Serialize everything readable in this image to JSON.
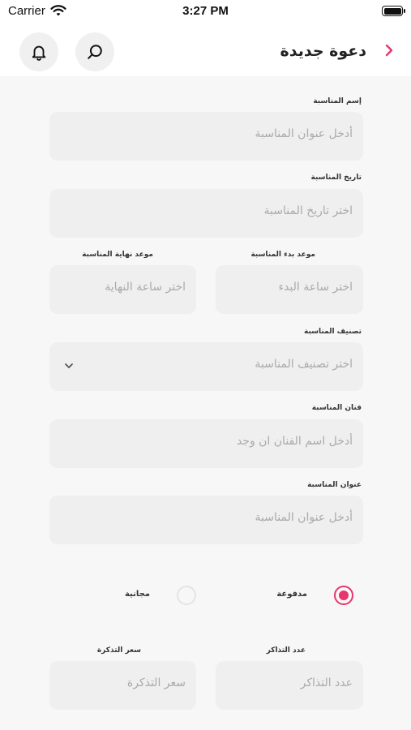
{
  "status_bar": {
    "carrier": "Carrier",
    "time": "3:27 PM"
  },
  "header": {
    "title": "دعوة جديدة"
  },
  "form": {
    "event_name": {
      "label": "إسم المناسبة",
      "placeholder": "أدخل عنوان المناسبة"
    },
    "event_date": {
      "label": "تاريخ المناسبة",
      "placeholder": "اختر تاريخ المناسبة"
    },
    "start_time": {
      "label": "موعد بدء المناسبة",
      "placeholder": "اختر ساعة البدء"
    },
    "end_time": {
      "label": "موعد نهاية المناسبة",
      "placeholder": "اختر ساعة النهاية"
    },
    "category": {
      "label": "تصنيف المناسبة",
      "placeholder": "اختر تصنيف المناسبة"
    },
    "artist": {
      "label": "فنان المناسبة",
      "placeholder": "أدخل اسم الفنان ان وجد"
    },
    "address": {
      "label": "عنوان المناسبة",
      "placeholder": "أدخل عنوان المناسبة"
    },
    "payment": {
      "paid_label": "مدفوعة",
      "free_label": "مجانية",
      "selected": "paid"
    },
    "ticket_count": {
      "label": "عدد التذاكر",
      "placeholder": "عدد التذاكر"
    },
    "ticket_price": {
      "label": "سعر التذكرة",
      "placeholder": "سعر التذكرة"
    }
  },
  "colors": {
    "accent": "#e6356f",
    "field_bg": "#efefef",
    "page_bg": "#f7f7f7"
  },
  "icons": {
    "back": "chevron-right-icon",
    "search": "search-icon",
    "notifications": "bell-icon",
    "dropdown": "chevron-down-icon"
  }
}
